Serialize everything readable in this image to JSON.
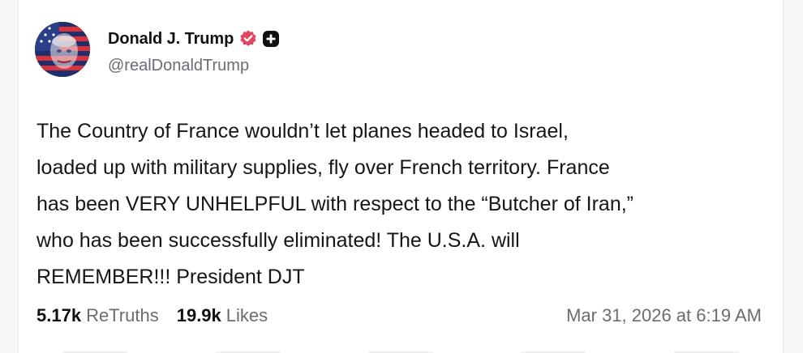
{
  "author": {
    "display_name": "Donald J. Trump",
    "handle": "@realDonaldTrump",
    "avatar_icon": "american-flag-portrait-avatar",
    "verified_icon": "verified-badge-icon",
    "verified_color": "#e0475f",
    "plus_icon": "truth-plus-icon"
  },
  "post": {
    "lines": [
      "The Country of France wouldn’t let planes headed to Israel,",
      "loaded up with military supplies, fly over French territory. France",
      "has been VERY UNHELPFUL with respect to the “Butcher of Iran,”",
      "who has been successfully eliminated! The U.S.A. will",
      "REMEMBER!!! President DJT"
    ]
  },
  "stats": {
    "retruths_count": "5.17k",
    "retruths_label": "ReTruths",
    "likes_count": "19.9k",
    "likes_label": "Likes"
  },
  "timestamp": "Mar 31, 2026 at 6:19 AM"
}
